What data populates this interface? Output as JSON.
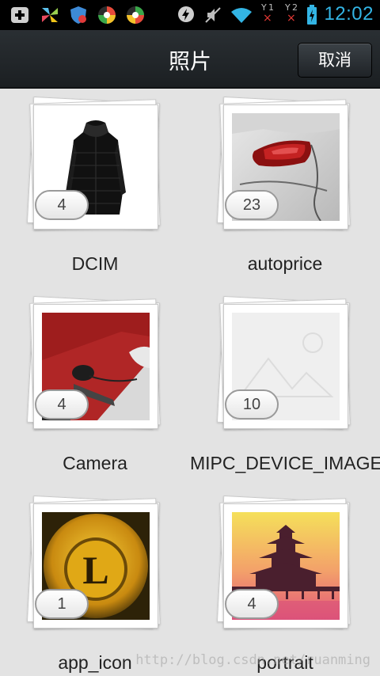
{
  "status_bar": {
    "time": "12:02",
    "sim1_label": "1",
    "sim2_label": "2",
    "icons": [
      "notification-plus-icon",
      "pinwheel-app-icon",
      "shield-app-icon",
      "browser-app-icon",
      "browser-app-icon-2",
      "lightning-icon",
      "mute-icon",
      "wifi-icon",
      "sim1-no-signal-icon",
      "sim2-no-signal-icon",
      "battery-charging-icon"
    ],
    "time_color": "#33b5e5"
  },
  "header": {
    "title": "照片",
    "cancel_label": "取消"
  },
  "albums": [
    {
      "name": "DCIM",
      "count": "4",
      "thumbnail": "black-coat-image"
    },
    {
      "name": "autoprice",
      "count": "23",
      "thumbnail": "car-taillight-image"
    },
    {
      "name": "Camera",
      "count": "4",
      "thumbnail": "desk-mouse-image"
    },
    {
      "name": "MIPC_DEVICE_IMAGE",
      "count": "10",
      "thumbnail": "placeholder-image"
    },
    {
      "name": "app_icon",
      "count": "1",
      "thumbnail": "gold-coin-image"
    },
    {
      "name": "portrait",
      "count": "4",
      "thumbnail": "pagoda-sunset-image"
    }
  ],
  "watermark": "http://blog.csdn.net/ruanming"
}
